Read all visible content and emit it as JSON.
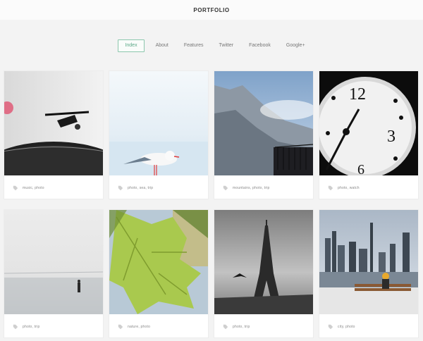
{
  "header": {
    "title": "PORTFOLIO"
  },
  "nav": {
    "items": [
      {
        "label": "Index",
        "active": true
      },
      {
        "label": "About"
      },
      {
        "label": "Features"
      },
      {
        "label": "Twitter"
      },
      {
        "label": "Facebook"
      },
      {
        "label": "Google+"
      }
    ]
  },
  "cards": [
    {
      "tags": "music, photo",
      "image": "turntable"
    },
    {
      "tags": "photo, sea, trip",
      "image": "seagull"
    },
    {
      "tags": "mountains, photo, trip",
      "image": "mountains"
    },
    {
      "tags": "photo, watch",
      "image": "clock"
    },
    {
      "tags": "photo, trip",
      "image": "foggy-sea"
    },
    {
      "tags": "nature, photo",
      "image": "leaf"
    },
    {
      "tags": "photo, trip",
      "image": "eiffel-tower"
    },
    {
      "tags": "city, photo",
      "image": "city-skyline"
    }
  ],
  "colors": {
    "accent": "#5aa887",
    "background": "#f3f3f3"
  }
}
